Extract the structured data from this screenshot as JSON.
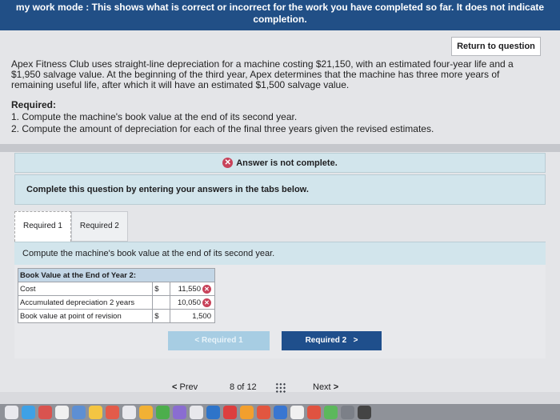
{
  "banner": {
    "line1": "my work mode : This shows what is correct or incorrect for the work you have completed so far. It does not indicate",
    "line2": "completion."
  },
  "return_button": "Return to question",
  "problem_text": "Apex Fitness Club uses straight-line depreciation for a machine costing $21,150, with an estimated four-year life and a $1,950 salvage value. At the beginning of the third year, Apex determines that the machine has three more years of remaining useful life, after which it will have an estimated $1,500 salvage value.",
  "required": {
    "title": "Required:",
    "items": [
      "1. Compute the machine's book value at the end of its second year.",
      "2. Compute the amount of depreciation for each of the final three years given the revised estimates."
    ]
  },
  "status": {
    "text": "Answer is not complete."
  },
  "instruction": "Complete this question by entering your answers in the tabs below.",
  "tabs": [
    "Required 1",
    "Required 2"
  ],
  "panel_heading": "Compute the machine's book value at the end of its second year.",
  "table": {
    "header": "Book Value at the End of Year 2:",
    "rows": [
      {
        "label": "Cost",
        "currency": "$",
        "value": "11,550",
        "incorrect": true
      },
      {
        "label": "Accumulated depreciation 2 years",
        "currency": "",
        "value": "10,050",
        "incorrect": true
      },
      {
        "label": "Book value at point of revision",
        "currency": "$",
        "value": "1,500",
        "incorrect": false
      }
    ]
  },
  "nav": {
    "prev_tab": "Required 1",
    "next_tab": "Required 2"
  },
  "pager": {
    "prev": "Prev",
    "current": "8",
    "of": "of",
    "total": "12",
    "next": "Next"
  },
  "colors": {
    "banner": "#214f86",
    "status_bg": "#d2e5ec",
    "incorrect": "#c8425a",
    "next_btn": "#1f4f8c"
  }
}
